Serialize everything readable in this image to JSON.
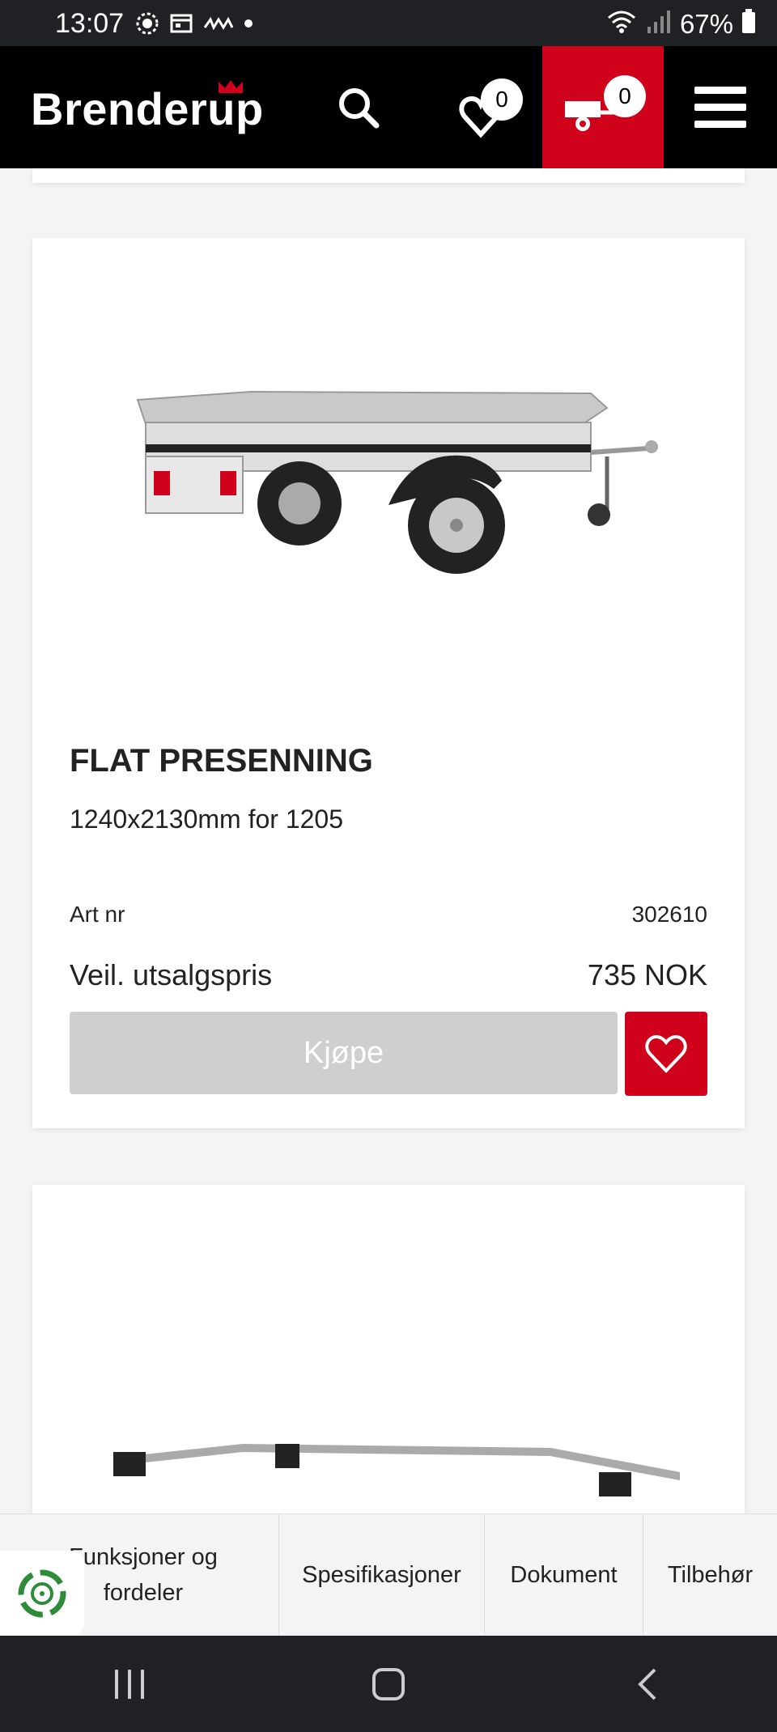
{
  "status_bar": {
    "time": "13:07",
    "battery": "67%"
  },
  "header": {
    "logo": "Brenderup",
    "wishlist_count": "0",
    "cart_count": "0"
  },
  "product": {
    "title": "FLAT PRESENNING",
    "subtitle": "1240x2130mm for 1205",
    "art_label": "Art nr",
    "art_value": "302610",
    "price_label": "Veil. utsalgspris",
    "price_value": "735 NOK",
    "buy_label": "Kjøpe"
  },
  "tabs": [
    {
      "label": "Funksjoner og fordeler"
    },
    {
      "label": "Spesifikasjoner"
    },
    {
      "label": "Dokument"
    },
    {
      "label": "Tilbehør"
    }
  ],
  "colors": {
    "accent": "#d0021b",
    "header_bg": "#000000",
    "button_disabled": "#cfcfcf"
  }
}
